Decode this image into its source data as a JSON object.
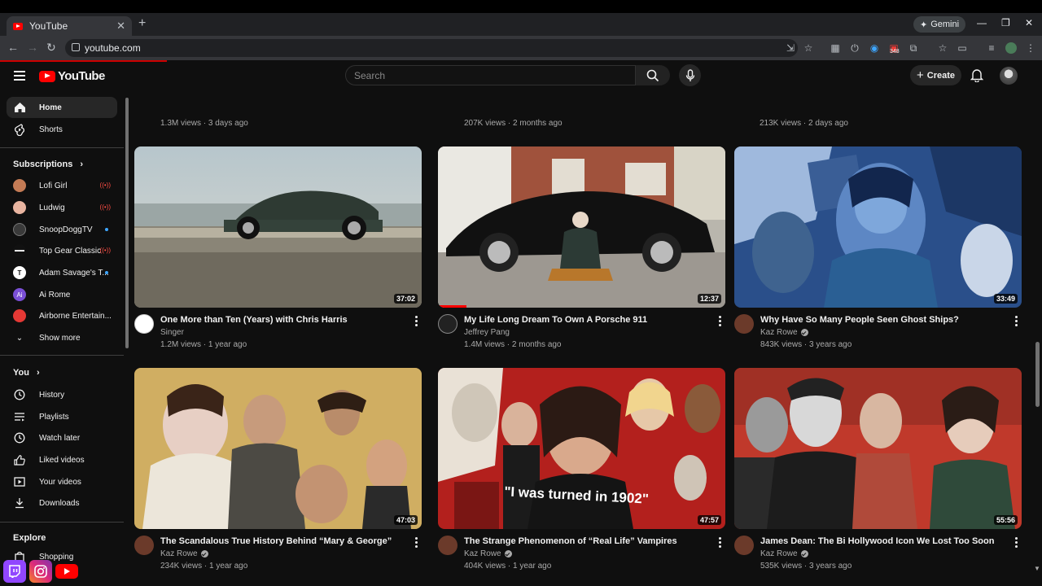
{
  "browser": {
    "tab_title": "YouTube",
    "url": "youtube.com",
    "gemini_label": "Gemini",
    "ext_badge": "348"
  },
  "masthead": {
    "logo_text": "YouTube",
    "search_placeholder": "Search",
    "create_label": "Create"
  },
  "sidebar": {
    "home": "Home",
    "shorts": "Shorts",
    "subscriptions_heading": "Subscriptions",
    "subscriptions": [
      {
        "name": "Lofi Girl",
        "status": "live",
        "color": "#c47b55"
      },
      {
        "name": "Ludwig",
        "status": "live",
        "color": "#e8b4a0"
      },
      {
        "name": "SnoopDoggTV",
        "status": "new",
        "color": "#3a3a3a"
      },
      {
        "name": "Top Gear Classic",
        "status": "live",
        "color": "#111111"
      },
      {
        "name": "Adam Savage's T...",
        "status": "new",
        "color": "#ffffff",
        "initial": "T"
      },
      {
        "name": "Ai Rome",
        "status": "none",
        "color": "#7a4fd6",
        "initial": "Ai"
      },
      {
        "name": "Airborne Entertain...",
        "status": "none",
        "color": "#e53935"
      }
    ],
    "show_more": "Show more",
    "you_heading": "You",
    "you_items": [
      "History",
      "Playlists",
      "Watch later",
      "Liked videos",
      "Your videos",
      "Downloads"
    ],
    "explore_heading": "Explore",
    "explore_items": [
      "Shopping"
    ]
  },
  "row0": [
    {
      "meta": "1.3M views · 3 days ago"
    },
    {
      "meta": "207K views · 2 months ago"
    },
    {
      "meta": "213K views · 2 days ago"
    }
  ],
  "videos": [
    {
      "title": "One More than Ten (Years) with Chris Harris",
      "channel": "Singer",
      "verified": false,
      "meta": "1.2M views · 1 year ago",
      "duration": "37:02",
      "progress": 0
    },
    {
      "title": "My Life Long Dream To Own A Porsche 911",
      "channel": "Jeffrey Pang",
      "verified": false,
      "meta": "1.4M views · 2 months ago",
      "duration": "12:37",
      "progress": 0.1
    },
    {
      "title": "Why Have So Many People Seen Ghost Ships?",
      "channel": "Kaz Rowe",
      "verified": true,
      "meta": "843K views · 3 years ago",
      "duration": "33:49",
      "progress": 0
    },
    {
      "title": "The Scandalous True History Behind “Mary & George”",
      "channel": "Kaz Rowe",
      "verified": true,
      "meta": "234K views · 1 year ago",
      "duration": "47:03",
      "progress": 0
    },
    {
      "title": "The Strange Phenomenon of “Real Life” Vampires",
      "channel": "Kaz Rowe",
      "verified": true,
      "meta": "404K views · 1 year ago",
      "duration": "47:57",
      "progress": 0,
      "caption": "\"I was turned in 1902\""
    },
    {
      "title": "James Dean: The Bi Hollywood Icon We Lost Too Soon",
      "channel": "Kaz Rowe",
      "verified": true,
      "meta": "535K views · 3 years ago",
      "duration": "55:56",
      "progress": 0
    }
  ]
}
